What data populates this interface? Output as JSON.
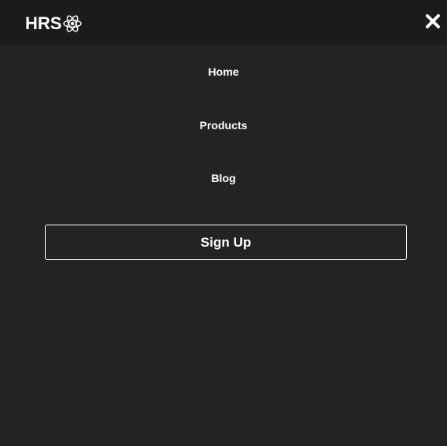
{
  "header": {
    "logo_text": "HRS",
    "logo_icon": "atom-icon",
    "close_icon": "close-icon"
  },
  "menu": {
    "items": [
      {
        "label": "Home"
      },
      {
        "label": "Products"
      },
      {
        "label": "Blog"
      }
    ],
    "signup_label": "Sign Up"
  },
  "colors": {
    "background": "#232323",
    "header_background": "#1b1b1b",
    "text": "#ffffff"
  }
}
